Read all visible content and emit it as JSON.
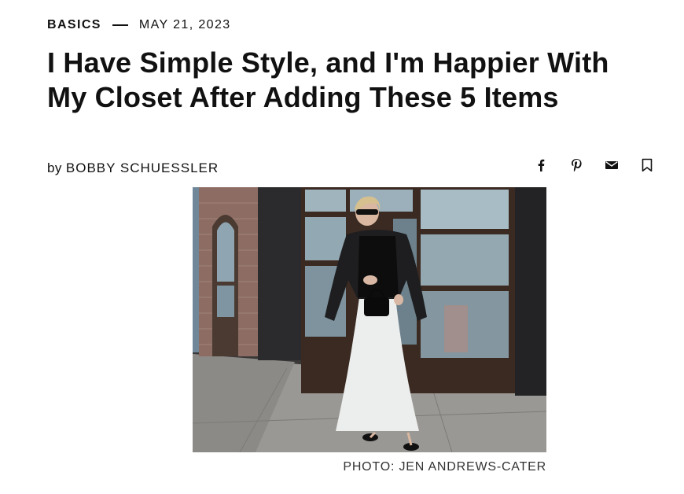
{
  "article": {
    "category": "BASICS",
    "date": "MAY 21, 2023",
    "title": "I Have Simple Style, and I'm Happier With My Closet After Adding These 5 Items",
    "byline_prefix": "by",
    "author": "BOBBY SCHUESSLER",
    "photo_credit": "PHOTO: JEN ANDREWS-CATER"
  },
  "share": {
    "icons": [
      "facebook-icon",
      "pinterest-icon",
      "email-icon",
      "bookmark-icon"
    ]
  }
}
